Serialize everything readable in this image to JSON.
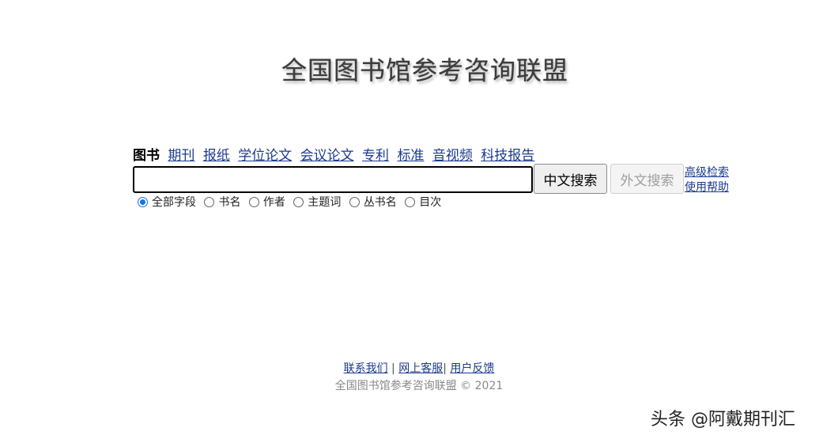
{
  "logo": {
    "text": "全国图书馆参考咨询联盟"
  },
  "categories": [
    {
      "label": "图书",
      "active": true
    },
    {
      "label": "期刊",
      "active": false
    },
    {
      "label": "报纸",
      "active": false
    },
    {
      "label": "学位论文",
      "active": false
    },
    {
      "label": "会议论文",
      "active": false
    },
    {
      "label": "专利",
      "active": false
    },
    {
      "label": "标准",
      "active": false
    },
    {
      "label": "音视频",
      "active": false
    },
    {
      "label": "科技报告",
      "active": false
    }
  ],
  "search": {
    "value": "",
    "placeholder": "",
    "chinese_button": "中文搜索",
    "foreign_button": "外文搜索"
  },
  "side_links": {
    "advanced": "高级检索",
    "help": "使用帮助"
  },
  "field_options": [
    {
      "label": "全部字段",
      "checked": true
    },
    {
      "label": "书名",
      "checked": false
    },
    {
      "label": "作者",
      "checked": false
    },
    {
      "label": "主题词",
      "checked": false
    },
    {
      "label": "丛书名",
      "checked": false
    },
    {
      "label": "目次",
      "checked": false
    }
  ],
  "footer": {
    "contact": "联系我们",
    "online_service": "网上客服",
    "feedback": "用户反馈",
    "separator": "|",
    "copyright": "全国图书馆参考咨询联盟 © 2021"
  },
  "watermark": "头条 @阿戴期刊汇",
  "colors": {
    "link": "#1b3a8c",
    "radio_checked": "#1a73e8",
    "disabled_text": "#a0a0a0"
  }
}
